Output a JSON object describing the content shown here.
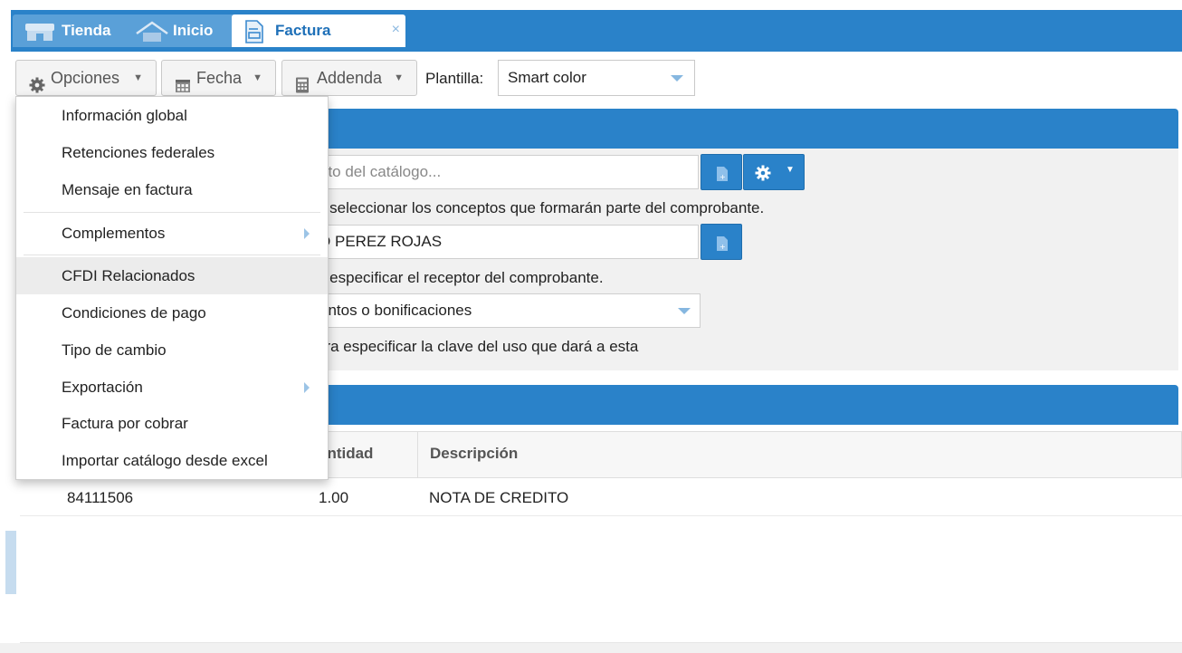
{
  "tabs": [
    {
      "label": "Tienda",
      "icon": "store-icon",
      "active": false
    },
    {
      "label": "Inicio",
      "icon": "home-icon",
      "active": false
    },
    {
      "label": "Factura",
      "icon": "invoice-icon",
      "active": true,
      "close": "×"
    }
  ],
  "toolbar": {
    "opciones_label": "Opciones",
    "fecha_label": "Fecha",
    "addenda_label": "Addenda",
    "plantilla_label": "Plantilla:",
    "plantilla_value": "Smart color"
  },
  "concepts": {
    "search_placeholder": "pto del catálogo...",
    "search_hint": "a seleccionar los conceptos que formarán parte del comprobante.",
    "receptor_value": "D PEREZ ROJAS",
    "receptor_hint": "a especificar el receptor del comprobante.",
    "uso_value": "entos o bonificaciones",
    "uso_hint": "ara especificar la clave del uso que dará a esta"
  },
  "table": {
    "columns": [
      "antidad",
      "Descripción"
    ],
    "rows": [
      {
        "clave": "84111506",
        "cantidad": "1.00",
        "descripcion": "NOTA DE CREDITO"
      }
    ]
  },
  "menu": {
    "items": [
      {
        "label": "Información global",
        "submenu": false
      },
      {
        "label": "Retenciones federales",
        "submenu": false
      },
      {
        "label": "Mensaje en factura",
        "submenu": false
      },
      {
        "label": "Complementos",
        "submenu": true
      },
      {
        "label": "CFDI Relacionados",
        "submenu": false,
        "highlighted": true
      },
      {
        "label": "Condiciones de pago",
        "submenu": false
      },
      {
        "label": "Tipo de cambio",
        "submenu": false
      },
      {
        "label": "Exportación",
        "submenu": true
      },
      {
        "label": "Factura por cobrar",
        "submenu": false
      },
      {
        "label": "Importar catálogo desde excel",
        "submenu": false
      }
    ]
  },
  "colors": {
    "accent": "#2a82c9",
    "tab_inactive": "#5aa0d8",
    "highlight": "#ececec"
  }
}
